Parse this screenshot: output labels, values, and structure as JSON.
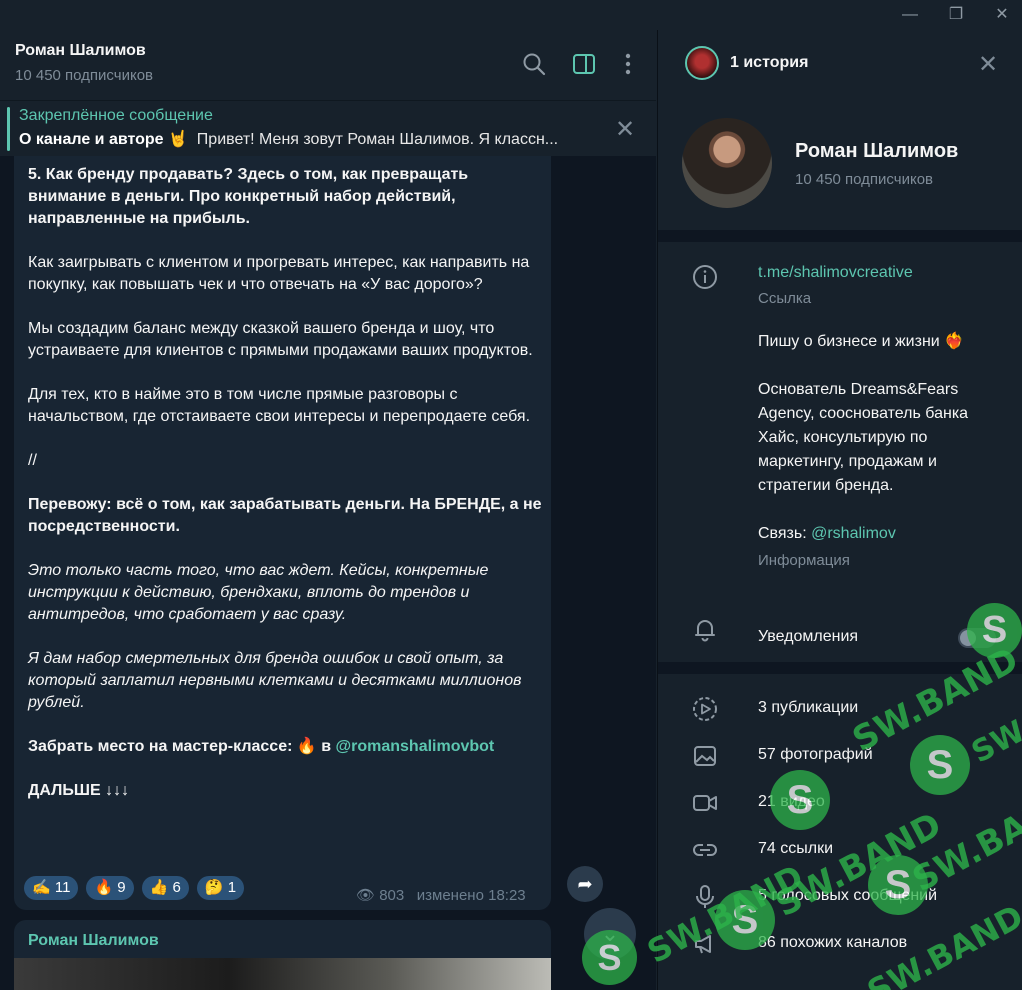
{
  "window": {
    "minimize": "—",
    "maximize": "❐",
    "close": "✕"
  },
  "chat": {
    "title": "Роман Шалимов",
    "subscribers": "10 450 подписчиков"
  },
  "pinned": {
    "title": "Закреплённое сообщение",
    "bold": "О канале и авторе 🤘",
    "text": "Привет! Меня зовут Роман Шалимов. Я классн..."
  },
  "message": {
    "p1": "5. Как бренду продавать? Здесь о том, как превращать внимание в деньги. Про конкретный набор действий, направленные на прибыль.",
    "p2": "Как заигрывать с клиентом и прогревать интерес, как направить на покупку, как повышать чек и что отвечать на «У вас дорого»?",
    "p3": "Мы создадим баланс между сказкой вашего бренда и шоу, что устраиваете для клиентов с прямыми продажами ваших продуктов.",
    "p4": "Для тех, кто в найме это в том числе прямые разговоры с начальством, где отстаиваете свои интересы и перепродаете себя.",
    "p5": "//",
    "p6": "Перевожу: всё о том, как зарабатывать деньги. На БРЕНДЕ, а не посредственности.",
    "p7": "Это только часть того, что вас ждет. Кейсы, конкретные инструкции к действию, брендхаки, вплоть до трендов и антитредов, что сработает у вас сразу.",
    "p8": "Я дам набор смертельных для бренда ошибок и свой опыт, за который заплатил нервными клетками и десятками миллионов рублей.",
    "p9_text": "Забрать место на мастер-классе: 🔥 в ",
    "p9_link": "@romanshalimovbot",
    "p10": "ДАЛЬШЕ ↓↓↓",
    "reactions": [
      {
        "emoji": "✍️",
        "count": "11"
      },
      {
        "emoji": "🔥",
        "count": "9"
      },
      {
        "emoji": "👍",
        "count": "6"
      },
      {
        "emoji": "🤔",
        "count": "1"
      }
    ],
    "views": "803",
    "edited": "изменено 18:23"
  },
  "message2": {
    "author": "Роман Шалимов"
  },
  "profile": {
    "stories": "1 история",
    "name": "Роман Шалимов",
    "subscribers": "10 450 подписчиков",
    "link": "t.me/shalimovcreative",
    "link_caption": "Ссылка",
    "bio1": "Пишу о бизнесе и жизни ❤️‍🔥",
    "bio2": "Основатель Dreams&Fears Agency, сооснователь банка Хайс, консультирую по маркетингу, продажам и стратегии бренда.",
    "contact_prefix": "Связь: ",
    "contact_link": "@rshalimov",
    "info_caption": "Информация",
    "notifications": "Уведомления",
    "notifications_on": false
  },
  "media": [
    {
      "icon": "story-icon",
      "label": "3 публикации"
    },
    {
      "icon": "photo-icon",
      "label": "57 фотографий"
    },
    {
      "icon": "video-icon",
      "label": "21 видео"
    },
    {
      "icon": "link-icon",
      "label": "74 ссылки"
    },
    {
      "icon": "mic-icon",
      "label": "5 голосовых сообщений"
    },
    {
      "icon": "megaphone-icon",
      "label": "86 похожих каналов"
    }
  ],
  "watermark": {
    "text": "SW.BAND",
    "letter": "S"
  },
  "colors": {
    "accent": "#5dc6b0",
    "background": "#0e1621",
    "panel": "#17212b",
    "bubble": "#182533",
    "watermark": "#2db34a"
  }
}
